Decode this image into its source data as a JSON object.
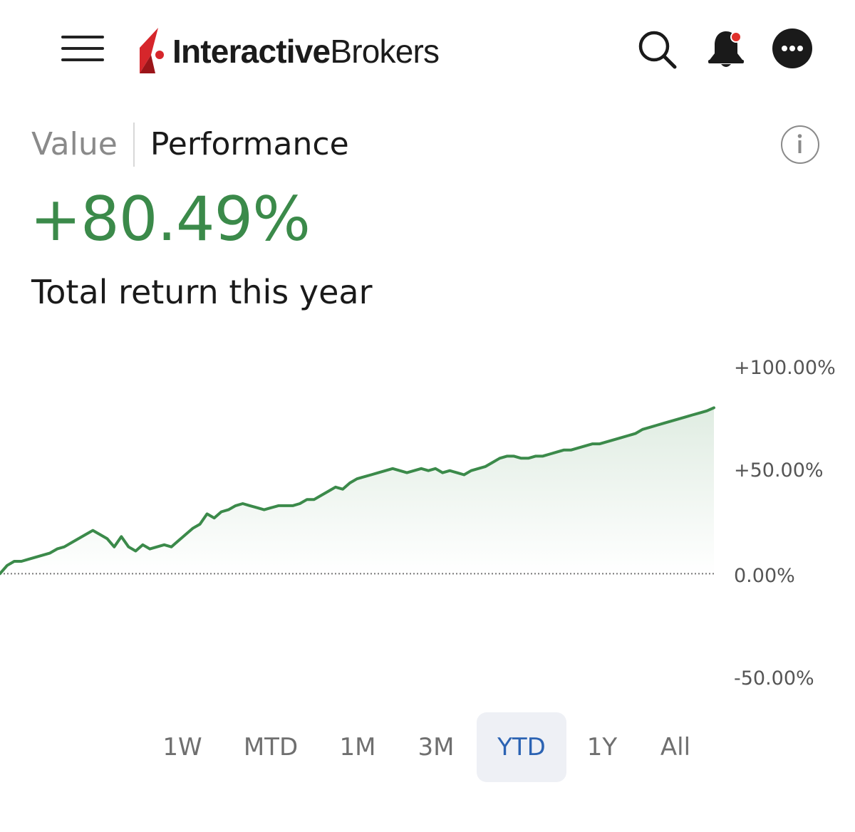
{
  "header": {
    "logo_bold": "Interactive",
    "logo_regular": "Brokers",
    "icons": [
      "menu-icon",
      "search-icon",
      "bell-icon",
      "more-icon"
    ],
    "notification_dot_color": "#e0302b"
  },
  "tabs": [
    {
      "label": "Value",
      "active": false
    },
    {
      "label": "Performance",
      "active": true
    }
  ],
  "summary": {
    "return_value": "+80.49%",
    "return_label": "Total return this year",
    "positive_color": "#3b8a4a"
  },
  "chart_data": {
    "type": "area",
    "y_ticks": [
      "+100.00%",
      "+50.00%",
      "0.00%",
      "-50.00%"
    ],
    "ylim": [
      -50,
      100
    ],
    "baseline": 0,
    "line_color": "#3b8a4a",
    "x_index": [
      0,
      1,
      2,
      3,
      4,
      5,
      6,
      7,
      8,
      9,
      10,
      11,
      12,
      13,
      14,
      15,
      16,
      17,
      18,
      19,
      20,
      21,
      22,
      23,
      24,
      25,
      26,
      27,
      28,
      29,
      30,
      31,
      32,
      33,
      34,
      35,
      36,
      37,
      38,
      39,
      40,
      41,
      42,
      43,
      44,
      45,
      46,
      47,
      48,
      49,
      50,
      51,
      52,
      53,
      54,
      55,
      56,
      57,
      58,
      59,
      60,
      61,
      62,
      63,
      64,
      65,
      66,
      67,
      68,
      69,
      70,
      71,
      72,
      73,
      74,
      75,
      76,
      77,
      78,
      79,
      80,
      81,
      82,
      83,
      84,
      85,
      86,
      87,
      88,
      89,
      90,
      91,
      92,
      93,
      94,
      95,
      96,
      97,
      98,
      99,
      100
    ],
    "values": [
      0,
      4,
      6,
      6,
      7,
      8,
      9,
      10,
      12,
      13,
      15,
      17,
      19,
      21,
      19,
      17,
      13,
      18,
      13,
      11,
      14,
      12,
      13,
      14,
      13,
      16,
      19,
      22,
      24,
      29,
      27,
      30,
      31,
      33,
      34,
      33,
      32,
      31,
      32,
      33,
      33,
      33,
      34,
      36,
      36,
      38,
      40,
      42,
      41,
      44,
      46,
      47,
      48,
      49,
      50,
      51,
      50,
      49,
      50,
      51,
      50,
      51,
      49,
      50,
      49,
      48,
      50,
      51,
      52,
      54,
      56,
      57,
      57,
      56,
      56,
      57,
      57,
      58,
      59,
      60,
      60,
      61,
      62,
      63,
      63,
      64,
      65,
      66,
      67,
      68,
      70,
      71,
      72,
      73,
      74,
      75,
      76,
      77,
      78,
      79,
      80.49
    ]
  },
  "periods": [
    {
      "label": "1W",
      "active": false
    },
    {
      "label": "MTD",
      "active": false
    },
    {
      "label": "1M",
      "active": false
    },
    {
      "label": "3M",
      "active": false
    },
    {
      "label": "YTD",
      "active": true
    },
    {
      "label": "1Y",
      "active": false
    },
    {
      "label": "All",
      "active": false
    }
  ]
}
